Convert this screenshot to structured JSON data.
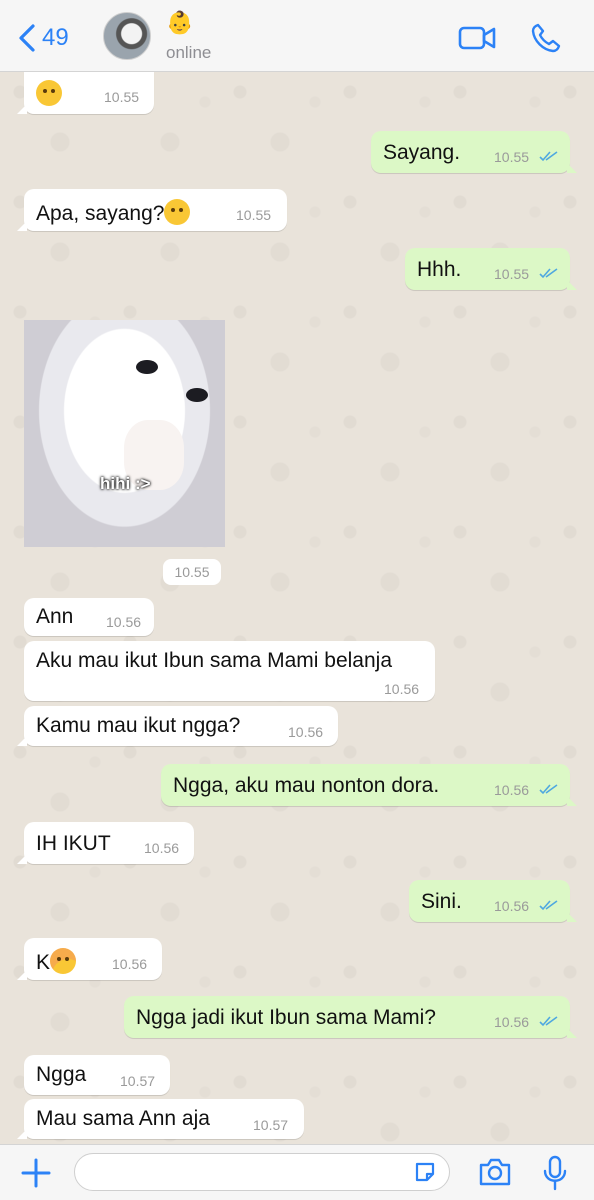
{
  "header": {
    "back_count": "49",
    "contact_emoji": "👶",
    "status": "online"
  },
  "messages": [
    {
      "dir": "in",
      "emoji": "worried",
      "text": "",
      "time": "10.55"
    },
    {
      "dir": "out",
      "text": "Sayang.",
      "time": "10.55",
      "read": true
    },
    {
      "dir": "in",
      "text": "Apa, sayang?",
      "emoji": "hand-over-mouth",
      "time": "10.55"
    },
    {
      "dir": "out",
      "text": "Hhh.",
      "time": "10.55",
      "read": true
    },
    {
      "dir": "in",
      "type": "sticker",
      "caption": "hihi :>",
      "time": "10.55"
    },
    {
      "dir": "in",
      "text": "Ann",
      "time": "10.56"
    },
    {
      "dir": "in",
      "text": "Aku mau ikut Ibun sama Mami belanja",
      "time": "10.56"
    },
    {
      "dir": "in",
      "text": "Kamu mau ikut ngga?",
      "time": "10.56"
    },
    {
      "dir": "out",
      "text": "Ngga, aku mau nonton dora.",
      "time": "10.56",
      "read": true
    },
    {
      "dir": "in",
      "text": "IH IKUT",
      "time": "10.56"
    },
    {
      "dir": "out",
      "text": "Sini.",
      "time": "10.56",
      "read": true
    },
    {
      "dir": "in",
      "text": "K",
      "emoji": "smiling-blush",
      "time": "10.56"
    },
    {
      "dir": "out",
      "text": "Ngga jadi ikut Ibun sama Mami?",
      "time": "10.56",
      "read": true
    },
    {
      "dir": "in",
      "text": "Ngga",
      "time": "10.57"
    },
    {
      "dir": "in",
      "text": "Mau sama Ann aja",
      "time": "10.57"
    }
  ],
  "composer": {
    "placeholder": ""
  },
  "colors": {
    "accent": "#2C82F6",
    "outgoing_bubble": "#DCF8C6",
    "incoming_bubble": "#FFFFFF",
    "read_ticks": "#4FA8E0"
  },
  "icons": [
    "chevron-left-icon",
    "video-call-icon",
    "phone-icon",
    "plus-icon",
    "sticker-icon",
    "camera-icon",
    "microphone-icon"
  ]
}
